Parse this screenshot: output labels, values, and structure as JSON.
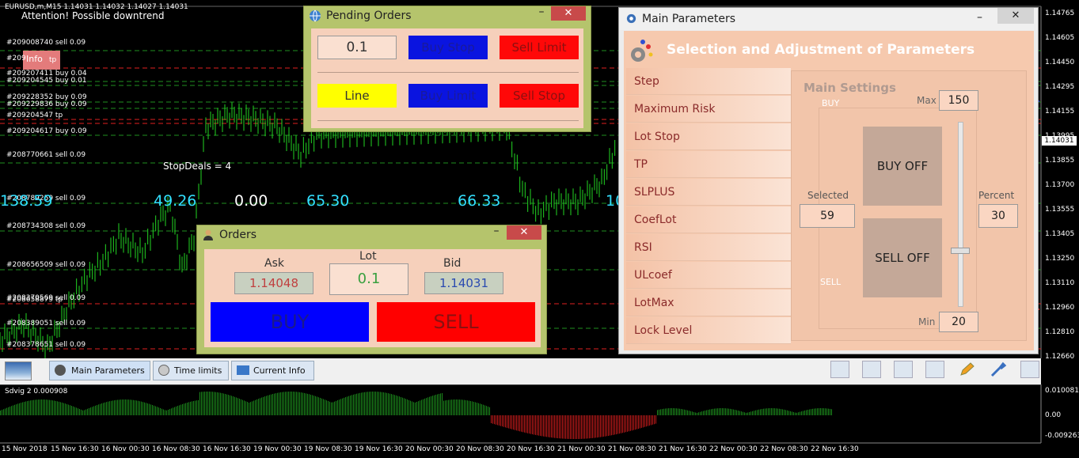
{
  "chart": {
    "header": "EURUSD,m,M15  1.14031 1.14032 1.14027 1.14031",
    "warning": "Attention! Possible  downtrend",
    "info_label": "Info",
    "stop_deals": "StopDeals = 4",
    "current_price": "1.14031",
    "price_axis": [
      "1.14765",
      "1.14605",
      "1.14450",
      "1.14295",
      "1.14155",
      "1.13995",
      "1.13855",
      "1.13700",
      "1.13555",
      "1.13405",
      "1.13250",
      "1.13110",
      "1.12960",
      "1.12810",
      "1.12660"
    ],
    "deal_labels": [
      "#209008740 sell 0.09",
      "#209",
      "tp",
      "#209207411 buy 0.04",
      "#209204545 buy 0.01",
      "#209228352 buy 0.09",
      "#209229836 buy 0.09",
      "#209204547 tp",
      "#209204617 buy 0.09",
      "#208770661 sell 0.09",
      "#208789259 sell 0.09",
      "#208734308 sell 0.09",
      "#208656509 sell 0.09",
      "#208370569 sell 0.09",
      "#208658879 tp",
      "#208389051 sell 0.09",
      "#208378651 sell 0.09"
    ],
    "big_values": [
      "138.59",
      "49.26",
      "0.00",
      "65.30",
      "66.33",
      "10"
    ],
    "colors": {
      "candle": "#22d622",
      "grid_green": "#1f8f1f",
      "line_red": "#e02020",
      "line_blue": "#2030d0",
      "text_cyan": "#33e0ff"
    }
  },
  "pending_orders": {
    "title": "Pending Orders",
    "lot_value": "0.1",
    "buttons": [
      "Buy Stop",
      "Sell Limit",
      "Line",
      "Buy Limit",
      "Sell Stop"
    ]
  },
  "orders": {
    "title": "Orders",
    "ask_label": "Ask",
    "lot_label": "Lot",
    "bid_label": "Bid",
    "ask_value": "1.14048",
    "lot_value": "0.1",
    "bid_value": "1.14031",
    "buy_label": "BUY",
    "sell_label": "SELL"
  },
  "main_params": {
    "title": "Main Parameters",
    "heading": "Selection and Adjustment of Parameters",
    "menu": [
      "Step",
      "Maximum Risk",
      "Lot Stop",
      "TP",
      "SLPLUS",
      "CoefLot",
      "RSI",
      "ULcoef",
      "LotMax",
      "Lock Level"
    ],
    "settings_title": "Main Settings",
    "buy_label": "BUY",
    "sell_label": "SELL",
    "max_label": "Max",
    "max_value": "150",
    "min_label": "Min",
    "min_value": "20",
    "selected_label": "Selected",
    "selected_value": "59",
    "percent_label": "Percent",
    "percent_value": "30",
    "buy_off": "BUY OFF",
    "sell_off": "SELL OFF"
  },
  "taskbar": {
    "tabs": [
      "Main Parameters",
      "Time limits",
      "Current Info"
    ]
  },
  "indicator": {
    "label": "Sdvig 2 0.000908",
    "axis": [
      "0.010081",
      "0.00",
      "-0.009263"
    ]
  },
  "dates": [
    "15 Nov 2018",
    "15 Nov 16:30",
    "16 Nov 00:30",
    "16 Nov 08:30",
    "16 Nov 16:30",
    "19 Nov 00:30",
    "19 Nov 08:30",
    "19 Nov 16:30",
    "20 Nov 00:30",
    "20 Nov 08:30",
    "20 Nov 16:30",
    "21 Nov 00:30",
    "21 Nov 08:30",
    "21 Nov 16:30",
    "22 Nov 00:30",
    "22 Nov 08:30",
    "22 Nov 16:30"
  ]
}
